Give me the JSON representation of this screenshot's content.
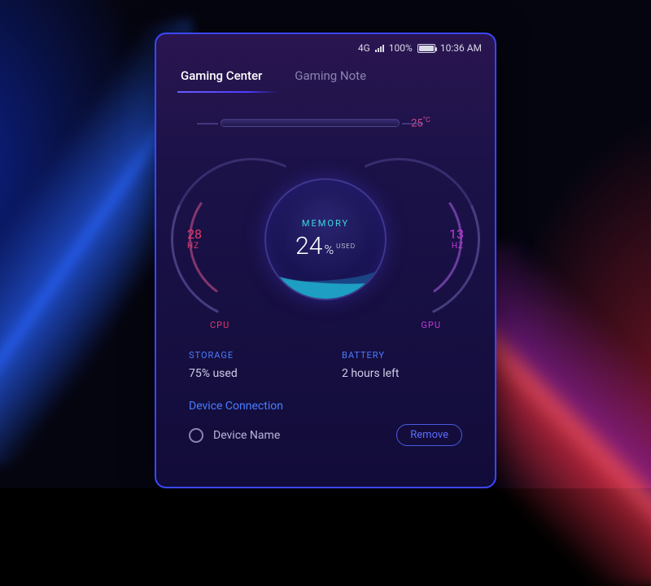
{
  "statusbar": {
    "network": "4G",
    "battery_pct": "100%",
    "time": "10:36 AM"
  },
  "tabs": {
    "active": "Gaming Center",
    "inactive": "Gaming Note"
  },
  "temperature": {
    "value": "25",
    "unit": "°C"
  },
  "gauge": {
    "left_value": "28",
    "left_unit": "HZ",
    "left_label": "CPU",
    "right_value": "13",
    "right_unit": "HZ",
    "right_label": "GPU",
    "center_label": "MEMORY",
    "center_value": "24",
    "center_pct": "%",
    "center_sub": "USED"
  },
  "stats": {
    "storage_label": "STORAGE",
    "storage_value": "75% used",
    "battery_label": "BATTERY",
    "battery_value": "2 hours left"
  },
  "connection": {
    "title": "Device Connection",
    "device_name": "Device Name",
    "remove_label": "Remove"
  }
}
